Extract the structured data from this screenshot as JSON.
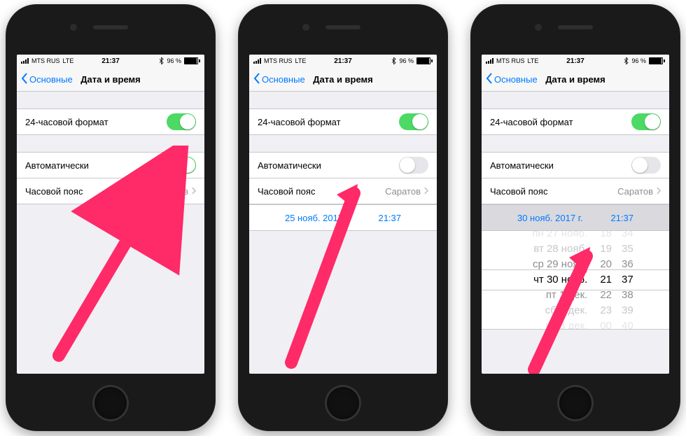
{
  "status": {
    "carrier": "MTS RUS",
    "network": "LTE",
    "time": "21:37",
    "battery_pct": "96 %"
  },
  "nav": {
    "back": "Основные",
    "title": "Дата и время"
  },
  "labels": {
    "format24": "24-часовой формат",
    "auto": "Автоматически",
    "timezone": "Часовой пояс",
    "timezone_value": "Саратов"
  },
  "screen2": {
    "date": "25 нояб. 2017 г.",
    "time": "21:37"
  },
  "screen3": {
    "date": "30 нояб. 2017 г.",
    "time": "21:37",
    "picker": {
      "dates": [
        "пн 27 нояб.",
        "вт 28 нояб.",
        "ср 29 нояб.",
        "чт 30 нояб.",
        "пт 1 дек.",
        "сб 2 дек.",
        "вс 3 дек."
      ],
      "hours": [
        "18",
        "19",
        "20",
        "21",
        "22",
        "23",
        "00"
      ],
      "minutes": [
        "34",
        "35",
        "36",
        "37",
        "38",
        "39",
        "40"
      ]
    }
  },
  "colors": {
    "accent": "#007aff",
    "arrow": "#ff2a68"
  }
}
